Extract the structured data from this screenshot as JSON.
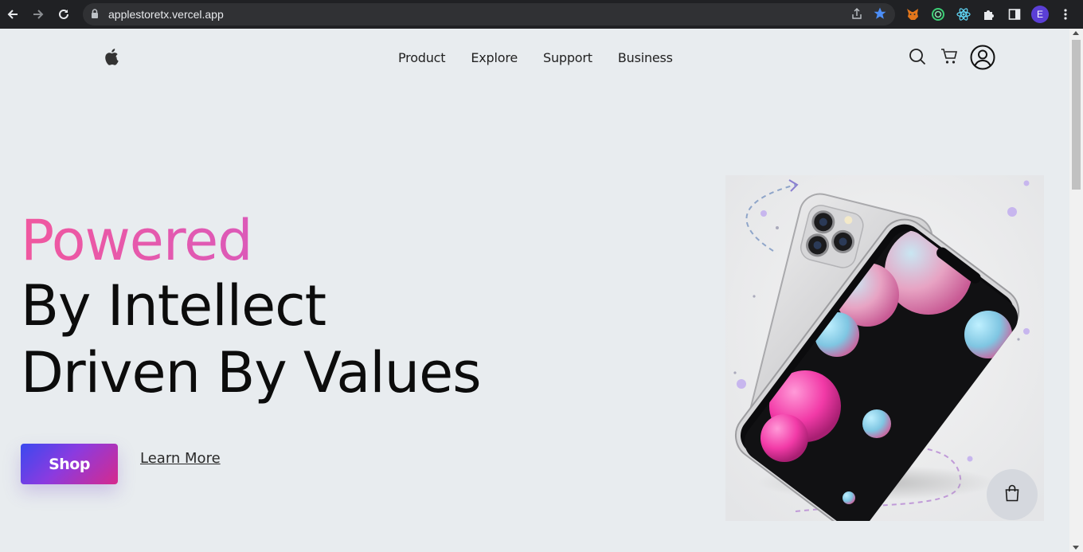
{
  "browser": {
    "url": "applestoretx.vercel.app",
    "profile_initial": "E",
    "icons": [
      "back-icon",
      "forward-icon",
      "reload-icon",
      "lock-icon",
      "share-icon",
      "bookmark-star-icon",
      "metamask-icon",
      "extension-ring-icon",
      "react-devtools-icon",
      "puzzle-extensions-icon",
      "side-panel-icon",
      "more-icon"
    ]
  },
  "nav": {
    "logo": "apple-logo-icon",
    "links": [
      "Product",
      "Explore",
      "Support",
      "Business"
    ],
    "icons": [
      "search-icon",
      "cart-icon",
      "user-icon"
    ]
  },
  "hero": {
    "line1": "Powered",
    "line2": "By Intellect",
    "line3": "Driven By Values",
    "shop_label": "Shop",
    "learn_more_label": "Learn More"
  },
  "floating": {
    "icon": "shopping-bag-icon"
  },
  "colors": {
    "page_bg": "#e8ecef",
    "accent_pink": "#f0589f",
    "accent_purple": "#c85bd1",
    "button_blue": "#3a49ef",
    "button_magenta": "#d62a8c"
  }
}
